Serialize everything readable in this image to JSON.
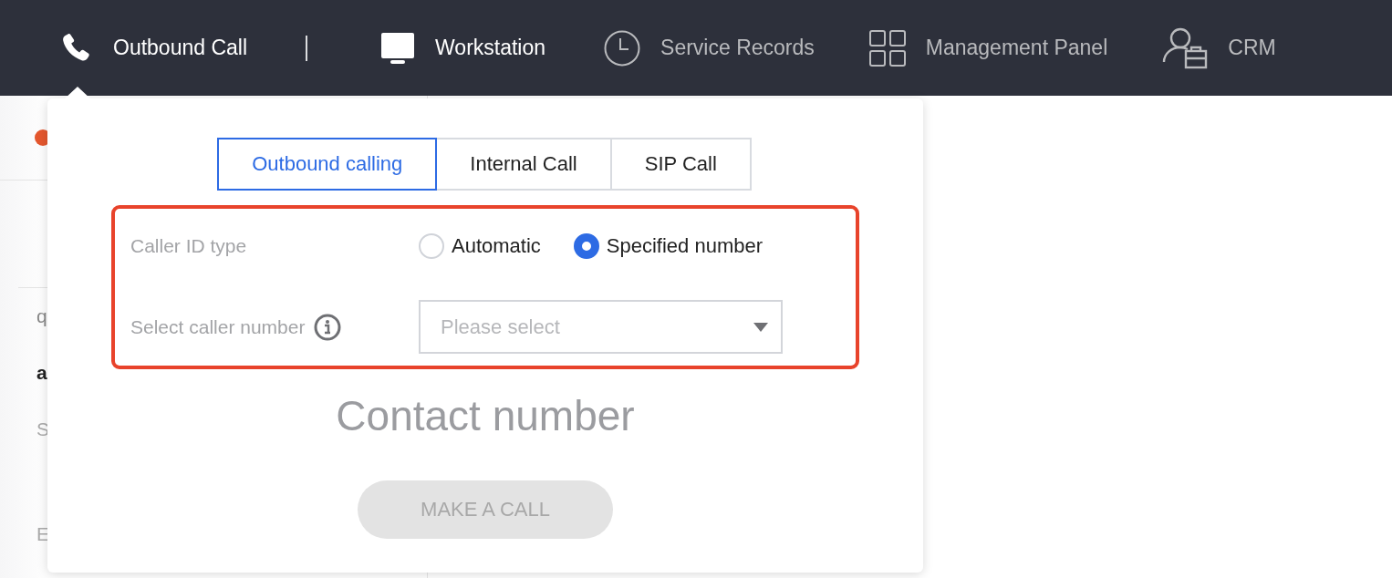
{
  "nav": {
    "items": [
      {
        "label": "Outbound Call",
        "highlighted": true
      },
      {
        "label": "Workstation",
        "highlighted": true
      },
      {
        "label": "Service Records",
        "highlighted": false
      },
      {
        "label": "Management Panel",
        "highlighted": false
      },
      {
        "label": "CRM",
        "highlighted": false
      }
    ]
  },
  "background": {
    "status_dot": {
      "color": "#e4572e"
    },
    "texts": [
      {
        "text": "q",
        "kind": "normal"
      },
      {
        "text": "a",
        "kind": "bold"
      },
      {
        "text": "S",
        "kind": "light"
      },
      {
        "text": "E",
        "kind": "light"
      }
    ]
  },
  "popup": {
    "tabs": [
      {
        "label": "Outbound calling",
        "selected": true
      },
      {
        "label": "Internal Call",
        "selected": false
      },
      {
        "label": "SIP Call",
        "selected": false
      }
    ],
    "caller_id_type": {
      "label": "Caller ID type",
      "options": [
        {
          "label": "Automatic",
          "selected": false
        },
        {
          "label": "Specified number",
          "selected": true
        }
      ]
    },
    "caller_number": {
      "label": "Select caller number",
      "placeholder": "Please select"
    },
    "contact_number": "Contact number",
    "call_button": {
      "label": "MAKE A CALL",
      "disabled": true
    }
  }
}
